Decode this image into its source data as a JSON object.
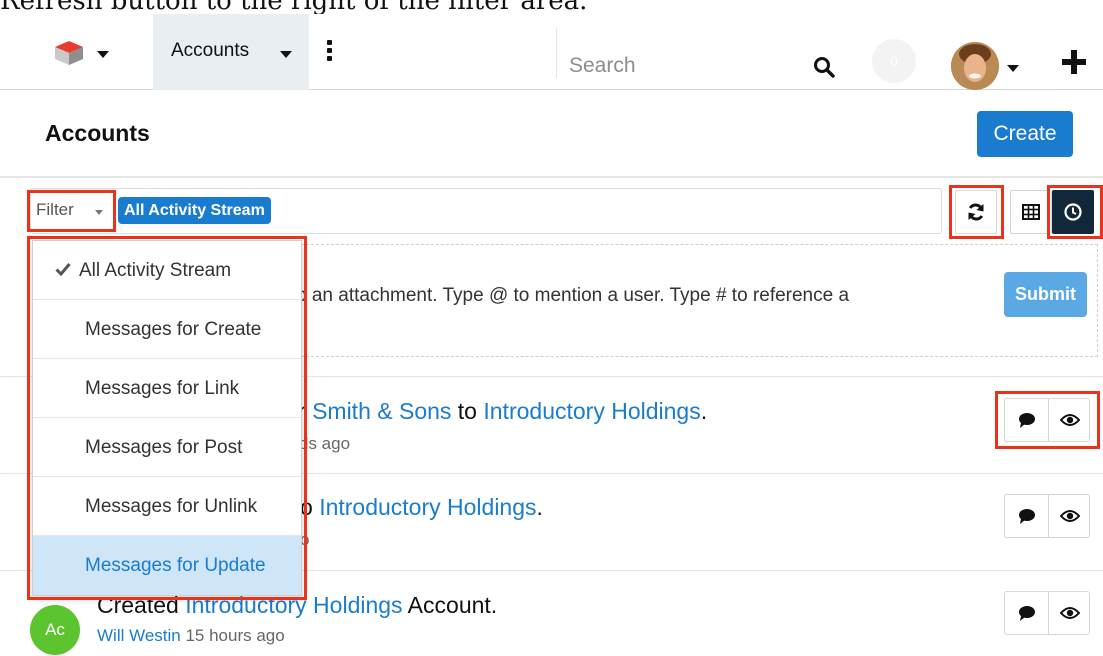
{
  "caption": "Refresh button to the right of the filter area.",
  "nav": {
    "module_label": "Accounts",
    "search_placeholder": "Search",
    "notification_count": "0"
  },
  "header": {
    "title": "Accounts",
    "create_label": "Create"
  },
  "filter": {
    "label": "Filter",
    "active_filter": "All Activity Stream"
  },
  "dropdown": {
    "items": [
      {
        "label": "All Activity Stream",
        "checked": true
      },
      {
        "label": "Messages for Create"
      },
      {
        "label": "Messages for Link"
      },
      {
        "label": "Messages for Post"
      },
      {
        "label": "Messages for Unlink"
      },
      {
        "label": "Messages for Update",
        "highlighted": true
      }
    ]
  },
  "composer": {
    "hint_visible": "p an attachment. Type @ to mention a user. Type # to reference a",
    "submit_label": "Submit"
  },
  "activities": [
    {
      "part_pre": "r ",
      "link1": "Smith & Sons",
      "part_mid": " to ",
      "link2": "Introductory Holdings",
      "part_end": ".",
      "meta": "ds ago"
    },
    {
      "part_pre": "o ",
      "link1": "Introductory Holdings",
      "part_end": ".",
      "meta": "o"
    },
    {
      "avatar_initials": "Ac",
      "part_pre": "Created ",
      "link1": "Introductory Holdings",
      "part_end": " Account.",
      "meta_user": "Will Westin",
      "meta_time": " 15 hours ago"
    }
  ],
  "colors": {
    "accent": "#1a7ccf",
    "callout": "#e8331d",
    "activity_button": "#12273a",
    "dropdown_highlight": "#cfe5f8",
    "avatar_green": "#5cc42f"
  },
  "icons": [
    "cube-logo-icon",
    "chevron-down-icon",
    "kebab-icon",
    "search-icon",
    "plus-icon",
    "refresh-icon",
    "list-view-icon",
    "clock-icon",
    "check-icon",
    "comment-icon",
    "eye-icon"
  ]
}
